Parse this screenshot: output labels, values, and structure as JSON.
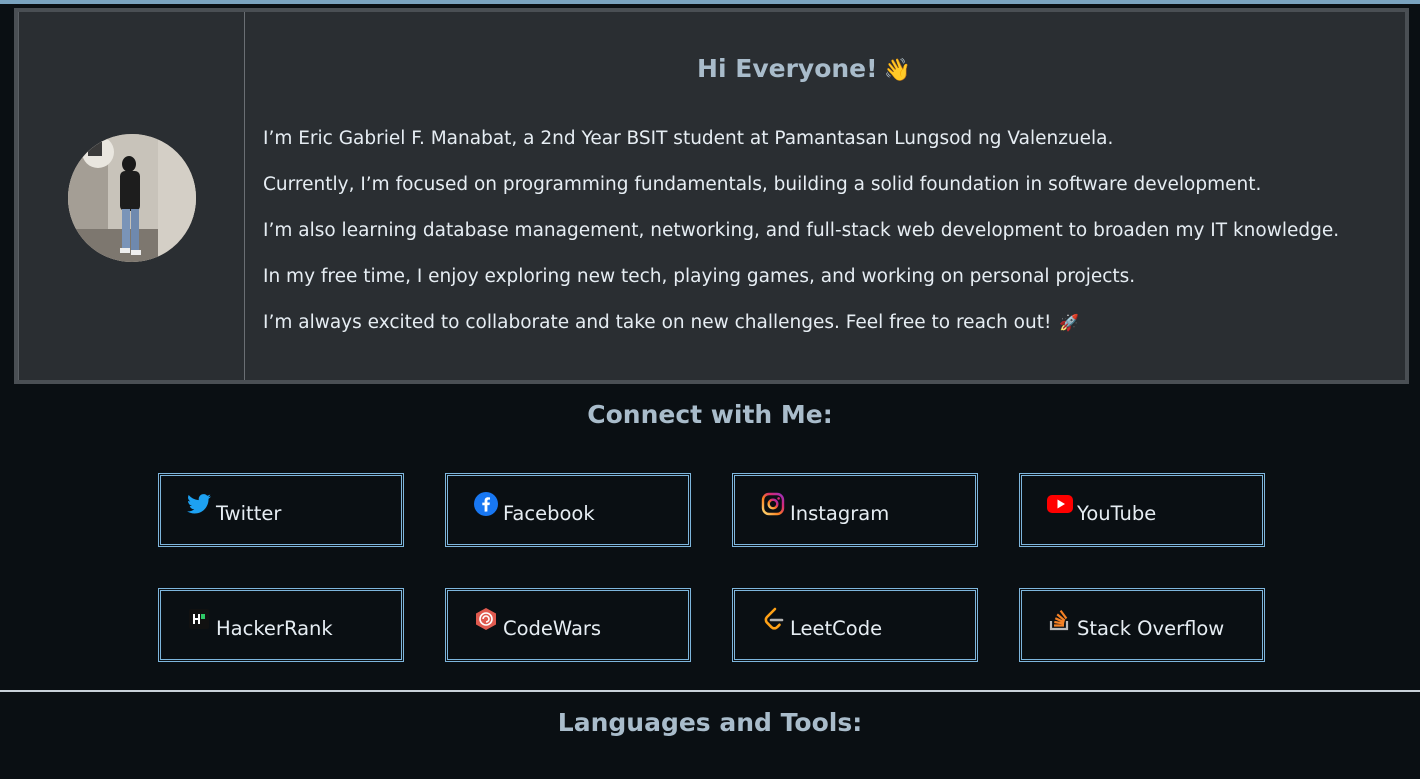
{
  "intro": {
    "title": "Hi Everyone!",
    "title_emoji": "👋",
    "bio": [
      "I’m Eric Gabriel F. Manabat, a 2nd Year BSIT student at Pamantasan Lungsod ng Valenzuela.",
      "Currently, I’m focused on programming fundamentals, building a solid foundation in software development.",
      "I’m also learning database management, networking, and full-stack web development to broaden my IT knowledge.",
      "In my free time, I enjoy exploring new tech, playing games, and working on personal projects.",
      "I’m always excited to collaborate and take on new challenges. Feel free to reach out!"
    ],
    "bio_emoji": "🚀"
  },
  "connect": {
    "title": "Connect with Me:",
    "links": [
      {
        "label": "Twitter",
        "icon": "twitter-icon",
        "color": "#1da1f2"
      },
      {
        "label": "Facebook",
        "icon": "facebook-icon",
        "color": "#1877f2"
      },
      {
        "label": "Instagram",
        "icon": "instagram-icon",
        "color": "#e1306c"
      },
      {
        "label": "YouTube",
        "icon": "youtube-icon",
        "color": "#ff0000"
      },
      {
        "label": "HackerRank",
        "icon": "hackerrank-icon",
        "color": "#2ec866"
      },
      {
        "label": "CodeWars",
        "icon": "codewars-icon",
        "color": "#e05a4f"
      },
      {
        "label": "LeetCode",
        "icon": "leetcode-icon",
        "color": "#ffa116"
      },
      {
        "label": "Stack Overflow",
        "icon": "stackoverflow-icon",
        "color": "#f48024"
      }
    ]
  },
  "languages": {
    "title": "Languages and Tools:"
  }
}
